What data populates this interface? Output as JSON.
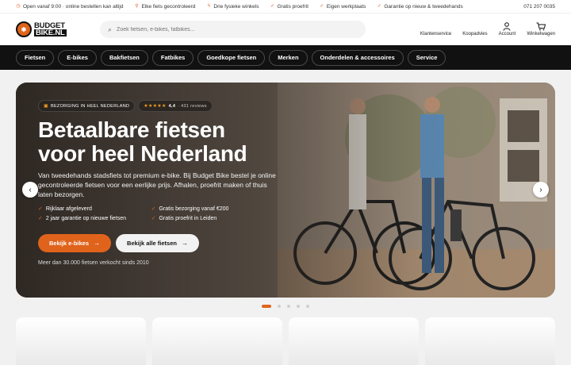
{
  "topbar": {
    "usps": [
      {
        "icon": "clock-icon",
        "text": "Open vanaf 9:00 · online bestellen kan altijd"
      },
      {
        "icon": "pin-icon",
        "text": "Elke fiets gecontroleerd"
      },
      {
        "icon": "bolt-icon",
        "text": "Drie fysieke winkels"
      },
      {
        "icon": "check-circle-icon",
        "text": "Gratis proefrit"
      },
      {
        "icon": "check-circle-icon",
        "text": "Eigen werkplaats"
      },
      {
        "icon": "check-circle-icon",
        "text": "Garantie op nieuw & tweedehands"
      }
    ],
    "phone": "071 207 0035"
  },
  "header": {
    "logo_line1": "BUDGET",
    "logo_line2": "BIKE.NL",
    "search_placeholder": "Zoek fietsen, e-bikes, fatbikes...",
    "icons": [
      {
        "name": "klantenservice",
        "label": "Klantenservice"
      },
      {
        "name": "koopadvies",
        "label": "Koopadvies"
      },
      {
        "name": "account",
        "label": "Account"
      },
      {
        "name": "winkelwagen",
        "label": "Winkelwagen"
      }
    ]
  },
  "nav": [
    "Fietsen",
    "E-bikes",
    "Bakfietsen",
    "Fatbikes",
    "Goedkope fietsen",
    "Merken",
    "Onderdelen & accessoires",
    "Service"
  ],
  "hero": {
    "badge_delivery": "BEZORGING IN HEEL NEDERLAND",
    "rating_stars": "★★★★★",
    "rating_value": "4,4",
    "rating_count": "· 431 reviews",
    "title": "Betaalbare fietsen voor heel Nederland",
    "lead": "Van tweedehands stadsfiets tot premium e-bike. Bij Budget Bike bestel je online gecontroleerde fietsen voor een eerlijke prijs. Afhalen, proefrit maken of thuis laten bezorgen.",
    "checks": [
      "Rijklaar afgeleverd",
      "Gratis bezorging vanaf €200",
      "2 jaar garantie op nieuwe fietsen",
      "Gratis proefrit in Leiden"
    ],
    "cta_primary": "Bekijk e-bikes",
    "cta_secondary": "Bekijk alle fietsen",
    "sold_note": "Meer dan 30.000 fietsen verkocht sinds 2010"
  },
  "carousel": {
    "slides": 5,
    "active": 1
  },
  "colors": {
    "accent": "#e0631c",
    "nav_bg": "#111111"
  }
}
